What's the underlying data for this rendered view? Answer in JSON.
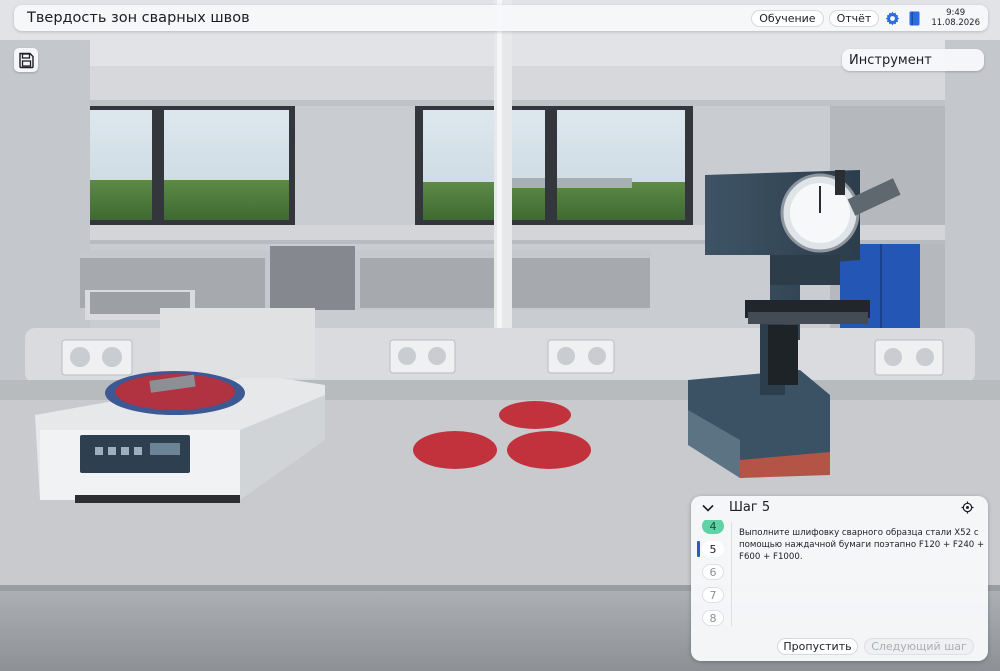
{
  "header": {
    "title": "Твердость зон сварных швов",
    "training_label": "Обучение",
    "report_label": "Отчёт",
    "time": "9:49",
    "date": "11.08.2026",
    "settings_icon": "gear-icon",
    "book_icon": "book-icon"
  },
  "toolbar": {
    "save_icon": "save-icon",
    "instrument_label": "Инструмент"
  },
  "step_panel": {
    "title": "Шаг 5",
    "collapse_icon": "chevron-down-icon",
    "locate_icon": "crosshair-icon",
    "steps": [
      {
        "number": "4",
        "state": "done"
      },
      {
        "number": "5",
        "state": "current"
      },
      {
        "number": "6",
        "state": "future"
      },
      {
        "number": "7",
        "state": "future"
      },
      {
        "number": "8",
        "state": "future"
      }
    ],
    "instruction": "Выполните шлифовку сварного образца стали Х52 с помощью наждачной бумаги поэтапно F120 + F240 + F600 + F1000.",
    "skip_label": "Пропустить",
    "next_label": "Следующий шаг"
  },
  "scene": {
    "polisher_display": "8888",
    "hardness_tester_dial": "dial-gauge"
  },
  "colors": {
    "accent": "#2c57c7",
    "done_step": "#5fd3a5",
    "target_marker": "#c1323d"
  }
}
